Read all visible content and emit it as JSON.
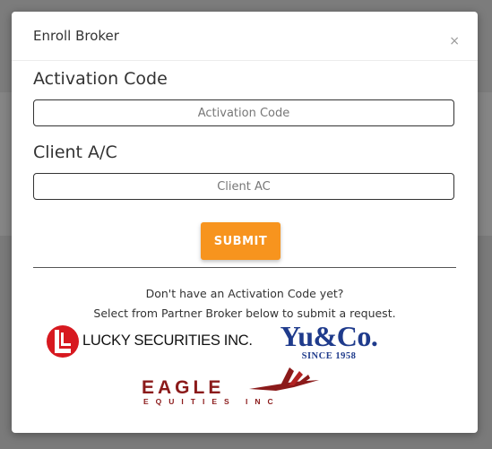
{
  "modal": {
    "title": "Enroll Broker",
    "close_label": "×"
  },
  "form": {
    "activation": {
      "label": "Activation Code",
      "placeholder": "Activation Code",
      "value": ""
    },
    "client": {
      "label": "Client A/C",
      "placeholder": "Client AC",
      "value": ""
    },
    "submit_label": "SUBMIT"
  },
  "info": {
    "line1": "Don't have an Activation Code yet?",
    "line2": "Select from Partner Broker below to submit a request."
  },
  "brokers": [
    {
      "name": "LUCKY SECURITIES INC.",
      "icon": "lucky-securities-logo-icon",
      "color": "#d71920"
    },
    {
      "name": "Yu&Co.",
      "tagline": "SINCE 1958",
      "color": "#1f3b8c"
    },
    {
      "name": "EAGLE",
      "tagline": "EQUITIES INC",
      "icon": "eagle-wing-icon",
      "color": "#8b1a1a"
    }
  ],
  "colors": {
    "accent": "#f7941e",
    "overlay": "#7c7c7c"
  }
}
